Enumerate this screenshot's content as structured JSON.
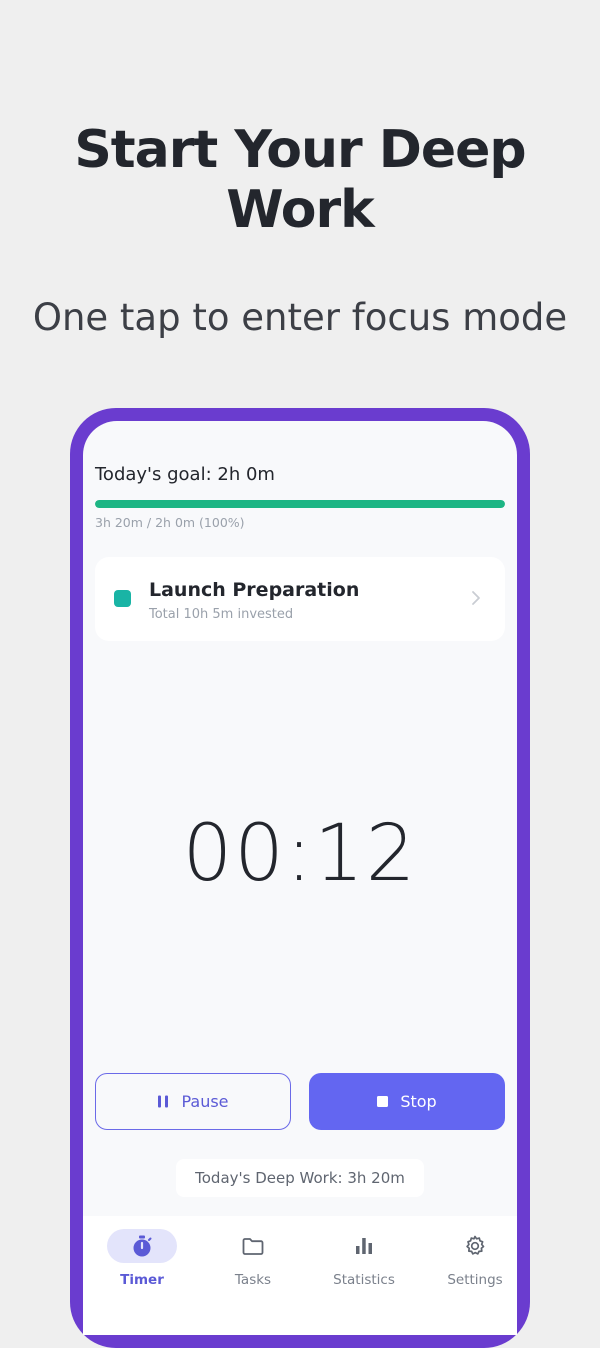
{
  "promo": {
    "headline": "Start Your Deep Work",
    "subline": "One tap to enter focus mode"
  },
  "goal": {
    "label": "Today's goal: 2h 0m",
    "progress_text": "3h 20m / 2h 0m (100%)",
    "progress_fraction": 1.0
  },
  "task": {
    "name": "Launch Preparation",
    "subtitle": "Total 10h 5m invested",
    "color": "#19b4a5",
    "icon": "chevron-right-icon"
  },
  "timer": {
    "display": "00:12"
  },
  "controls": {
    "pause_label": "Pause",
    "pause_icon": "pause-icon",
    "stop_label": "Stop",
    "stop_icon": "stop-icon"
  },
  "summary": {
    "text": "Today's Deep Work: 3h 20m"
  },
  "tabs": [
    {
      "label": "Timer",
      "icon": "stopwatch-icon",
      "active": true
    },
    {
      "label": "Tasks",
      "icon": "folder-icon",
      "active": false
    },
    {
      "label": "Statistics",
      "icon": "bar-chart-icon",
      "active": false
    },
    {
      "label": "Settings",
      "icon": "gear-icon",
      "active": false
    }
  ],
  "colors": {
    "accent": "#6366f1",
    "frame": "#6a3ccf",
    "progress": "#1db584"
  }
}
